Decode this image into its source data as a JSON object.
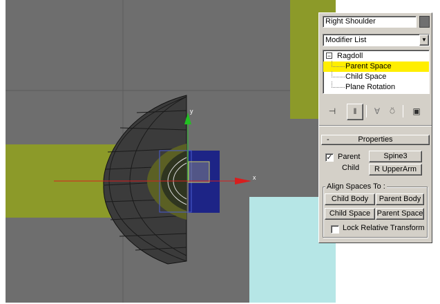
{
  "viewport": {
    "axis_x_label": "x",
    "axis_y_label": "y",
    "colors": {
      "background": "#6e6e6e",
      "grid": "#5a5a5a",
      "olive": "#8c9a29",
      "cyan": "#b6e6e6",
      "navy": "#1d2486",
      "mesh": "#3a3a3a",
      "axis_x": "#d81e1e",
      "axis_y": "#22c022"
    }
  },
  "panel": {
    "object_name": "Right Shoulder",
    "modifier_list": "Modifier List",
    "stack": [
      {
        "label": "Ragdoll",
        "expander": "−",
        "selected": false
      },
      {
        "label": "Parent Space",
        "selected": true
      },
      {
        "label": "Child Space",
        "selected": false
      },
      {
        "label": "Plane Rotation",
        "selected": false
      }
    ],
    "toolbar_icons": [
      "pin-stack-icon",
      "show-end-result-icon",
      "make-unique-icon",
      "remove-modifier-icon",
      "configure-modifier-sets-icon"
    ],
    "rollout": {
      "collapse": "-",
      "title": "Properties",
      "parent_label": "Parent",
      "parent_checked": true,
      "parent_checkmark": "✓",
      "parent_value": "Spine3",
      "child_label": "Child",
      "child_value": "R UpperArm",
      "align_title": "Align Spaces To :",
      "buttons": [
        "Child Body",
        "Parent Body",
        "Child Space",
        "Parent Space"
      ],
      "lock_label": "Lock Relative Transform",
      "lock_checked": false
    },
    "colors": {
      "face": "#d4d0c8",
      "selection": "#ffee00"
    }
  }
}
